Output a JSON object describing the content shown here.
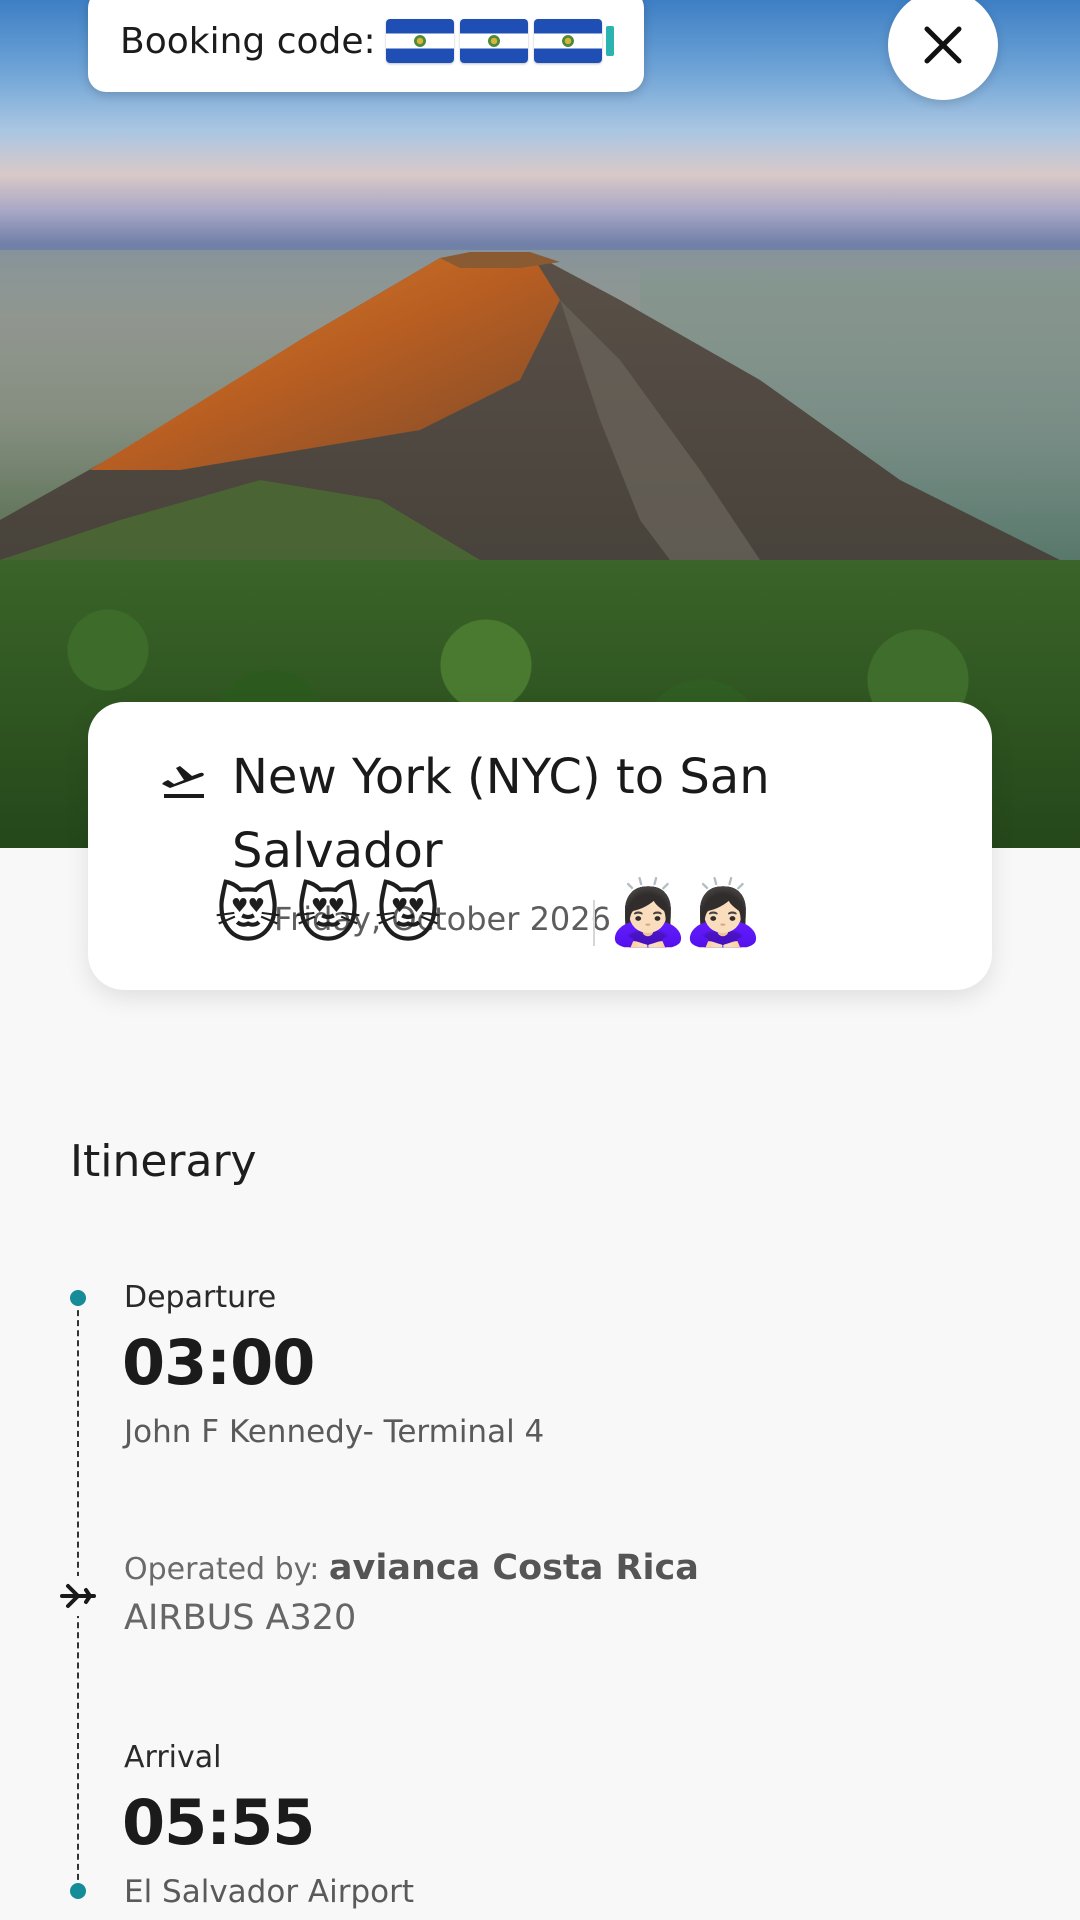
{
  "booking": {
    "label": "Booking code:",
    "code_flag_icons": [
      "el-salvador-flag",
      "el-salvador-flag",
      "el-salvador-flag"
    ]
  },
  "close_button": {
    "icon": "close-icon"
  },
  "route": {
    "icon": "airplane-takeoff-icon",
    "title": "New York (NYC) to San Salvador",
    "date_text": "Friday, October 2026",
    "date_emojis": [
      "😻",
      "😻",
      "😻"
    ],
    "passenger_emojis": [
      "🙇🏻‍♀️",
      "🙇🏻‍♀️"
    ]
  },
  "itinerary": {
    "heading": "Itinerary",
    "departure": {
      "label": "Departure",
      "time": "03:00",
      "place": "John F Kennedy- Terminal 4"
    },
    "operated_by_label": "Operated by:",
    "airline": "avianca Costa Rica",
    "aircraft": "AIRBUS A320",
    "arrival": {
      "label": "Arrival",
      "time": "05:55",
      "place": "El Salvador Airport"
    }
  },
  "colors": {
    "timeline_dot": "#168c99",
    "background": "#f8f8f8",
    "card": "#ffffff"
  }
}
